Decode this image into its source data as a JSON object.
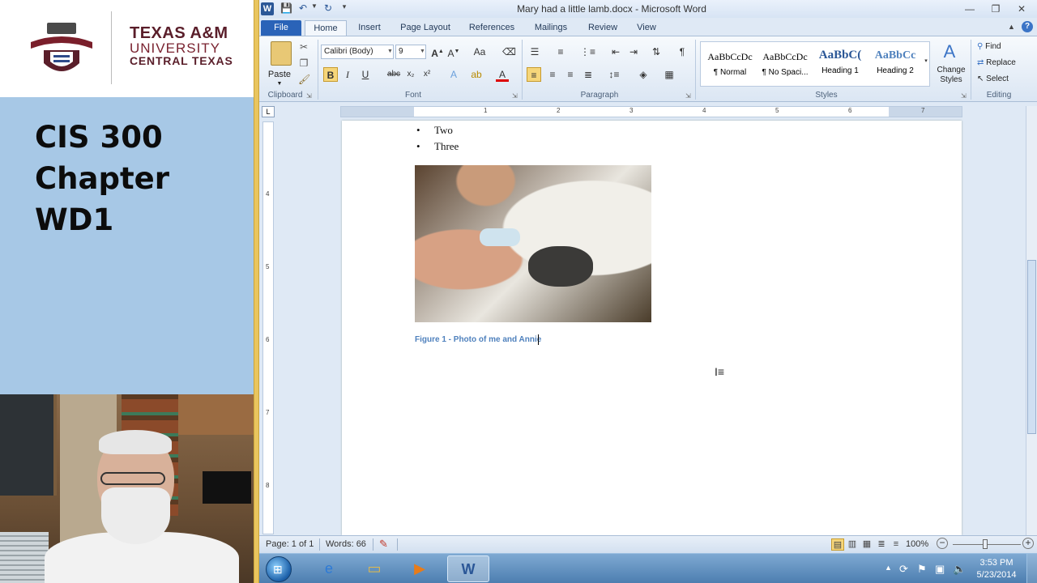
{
  "slide": {
    "logo": {
      "line1": "TEXAS A&M",
      "line2": "UNIVERSITY",
      "line3": "CENTRAL TEXAS"
    },
    "course": "CIS 300",
    "chapter": "Chapter WD1"
  },
  "window": {
    "title": "Mary had a little lamb.docx - Microsoft Word"
  },
  "tabs": [
    "File",
    "Home",
    "Insert",
    "Page Layout",
    "References",
    "Mailings",
    "Review",
    "View"
  ],
  "ribbon": {
    "clipboard": {
      "label": "Clipboard",
      "paste": "Paste"
    },
    "font": {
      "label": "Font",
      "name": "Calibri (Body)",
      "size": "9"
    },
    "paragraph": {
      "label": "Paragraph"
    },
    "styles": {
      "label": "Styles",
      "items": [
        {
          "preview": "AaBbCcDc",
          "name": "¶ Normal"
        },
        {
          "preview": "AaBbCcDc",
          "name": "¶ No Spaci..."
        },
        {
          "preview": "AaBbC(",
          "name": "Heading 1"
        },
        {
          "preview": "AaBbCc",
          "name": "Heading 2"
        }
      ],
      "change_styles_1": "Change",
      "change_styles_2": "Styles"
    },
    "editing": {
      "label": "Editing",
      "find": "Find",
      "replace": "Replace",
      "select": "Select"
    }
  },
  "ruler": [
    "1",
    "2",
    "3",
    "4",
    "5",
    "6",
    "7"
  ],
  "vruler": [
    "4",
    "5",
    "6",
    "7",
    "8"
  ],
  "document": {
    "bullets": [
      "Two",
      "Three"
    ],
    "caption": "Figure 1 - Photo of me and Annie"
  },
  "status": {
    "page": "Page: 1 of 1",
    "words": "Words: 66",
    "zoom": "100%",
    "zoom_level": 1.0
  },
  "taskbar": {
    "time": "3:53 PM",
    "date": "5/23/2014"
  },
  "colors": {
    "accent": "#2a63b8",
    "caption": "#4f81bd",
    "slide_bg": "#a7c8e6"
  }
}
